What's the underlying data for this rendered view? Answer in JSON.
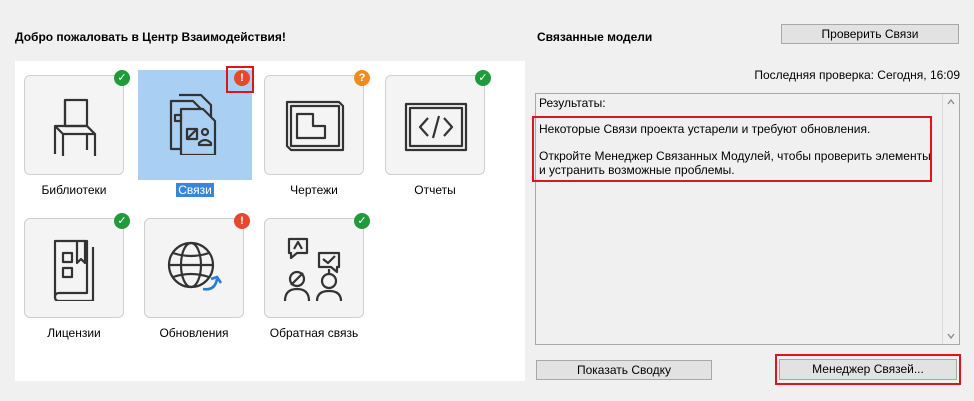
{
  "welcome_title": "Добро пожаловать в Центр Взаимодействия!",
  "tiles": [
    {
      "label": "Библиотеки",
      "icon": "chair-icon",
      "status": "ok"
    },
    {
      "label": "Связи",
      "icon": "linked-documents-icon",
      "status": "error"
    },
    {
      "label": "Чертежи",
      "icon": "drawing-sheet-icon",
      "status": "warning"
    },
    {
      "label": "Отчеты",
      "icon": "code-report-icon",
      "status": "ok"
    },
    {
      "label": "Лицензии",
      "icon": "license-book-icon",
      "status": "ok"
    },
    {
      "label": "Обновления",
      "icon": "globe-update-icon",
      "status": "error"
    },
    {
      "label": "Обратная связь",
      "icon": "feedback-people-icon",
      "status": "ok"
    }
  ],
  "badge_glyphs": {
    "ok": "✓",
    "error": "!",
    "warning": "?"
  },
  "linked_models": {
    "title": "Связанные модели",
    "check_button": "Проверить Связи",
    "last_check": "Последняя проверка: Сегодня, 16:09",
    "results_label": "Результаты:",
    "message_line1": "Некоторые Связи проекта устарели и требуют обновления.",
    "message_line2": "Откройте Менеджер Связанных Модулей, чтобы проверить элементы и устранить возможные проблемы.",
    "summary_button": "Показать Сводку",
    "manager_button": "Менеджер Связей..."
  },
  "colors": {
    "ok": "#1f9b3a",
    "error": "#e8472b",
    "warning": "#f08c1e",
    "highlight": "#e0141e",
    "selected": "#a9cff2"
  }
}
